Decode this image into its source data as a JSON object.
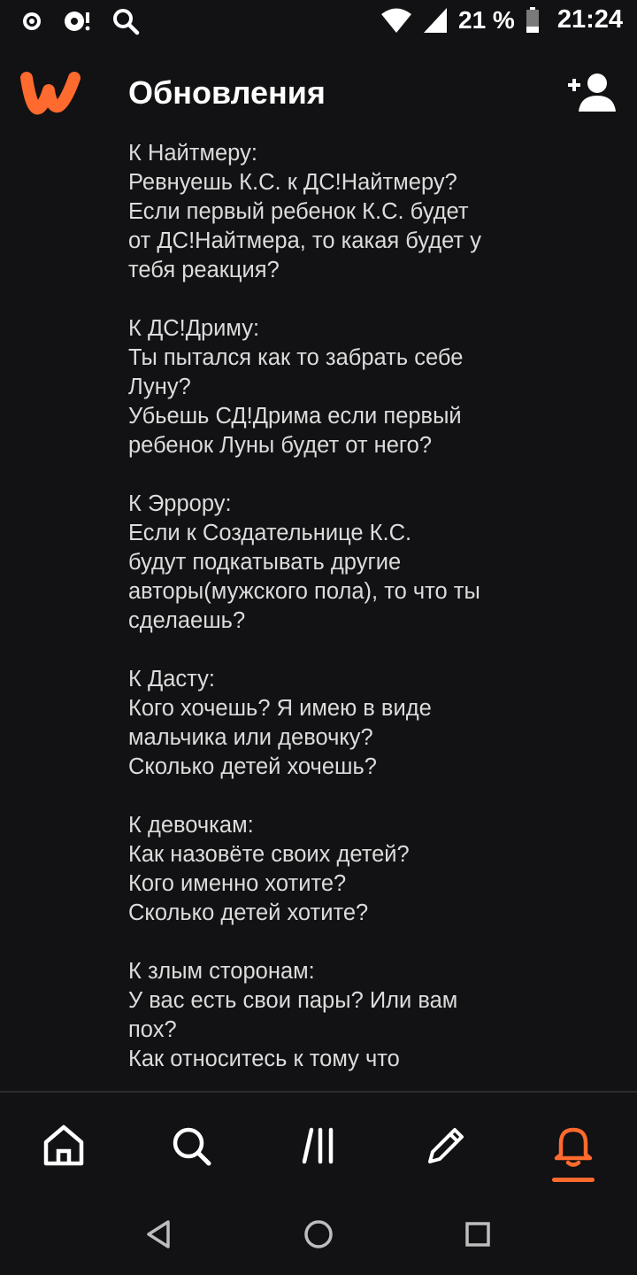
{
  "status_bar": {
    "battery_percent": "21 %",
    "time": "21:24",
    "icons": [
      "media-icon",
      "cast-icon",
      "search-icon",
      "wifi-icon",
      "signal-icon",
      "battery-icon"
    ]
  },
  "app_bar": {
    "title": "Обновления",
    "logo": "wattpad-logo",
    "action_icon": "add-user-icon",
    "accent_color": "#ff6a2e"
  },
  "message": {
    "paragraphs": [
      "К Найтмеру:\nРевнуешь К.С. к ДС!Найтмеру?\nЕсли первый ребенок К.С. будет\nот ДС!Найтмера, то какая будет у\nтебя реакция?",
      "К ДС!Дриму:\nТы пытался как то забрать себе\nЛуну?\nУбьешь СД!Дрима если первый\nребенок Луны будет от него?",
      "К Эррору:\nЕсли к Создательнице К.С.\nбудут подкатывать другие\nавторы(мужского пола), то что ты\nсделаешь?",
      "К Дасту:\nКого хочешь? Я имею в виде\nмальчика или девочку?\nСколько детей хочешь?",
      "К девочкам:\nКак назовёте своих детей?\nКого именно хотите?\nСколько детей хотите?",
      "К злым сторонам:\nУ вас есть свои пары? Или вам\nпох?\nКак относитесь к тому что"
    ]
  },
  "bottom_nav": {
    "items": [
      {
        "icon": "home-icon",
        "active": false
      },
      {
        "icon": "search-icon",
        "active": false
      },
      {
        "icon": "library-icon",
        "active": false
      },
      {
        "icon": "write-icon",
        "active": false
      },
      {
        "icon": "bell-icon",
        "active": true
      }
    ]
  },
  "system_nav": {
    "buttons": [
      "back-icon",
      "home-circle-icon",
      "recents-icon"
    ]
  }
}
